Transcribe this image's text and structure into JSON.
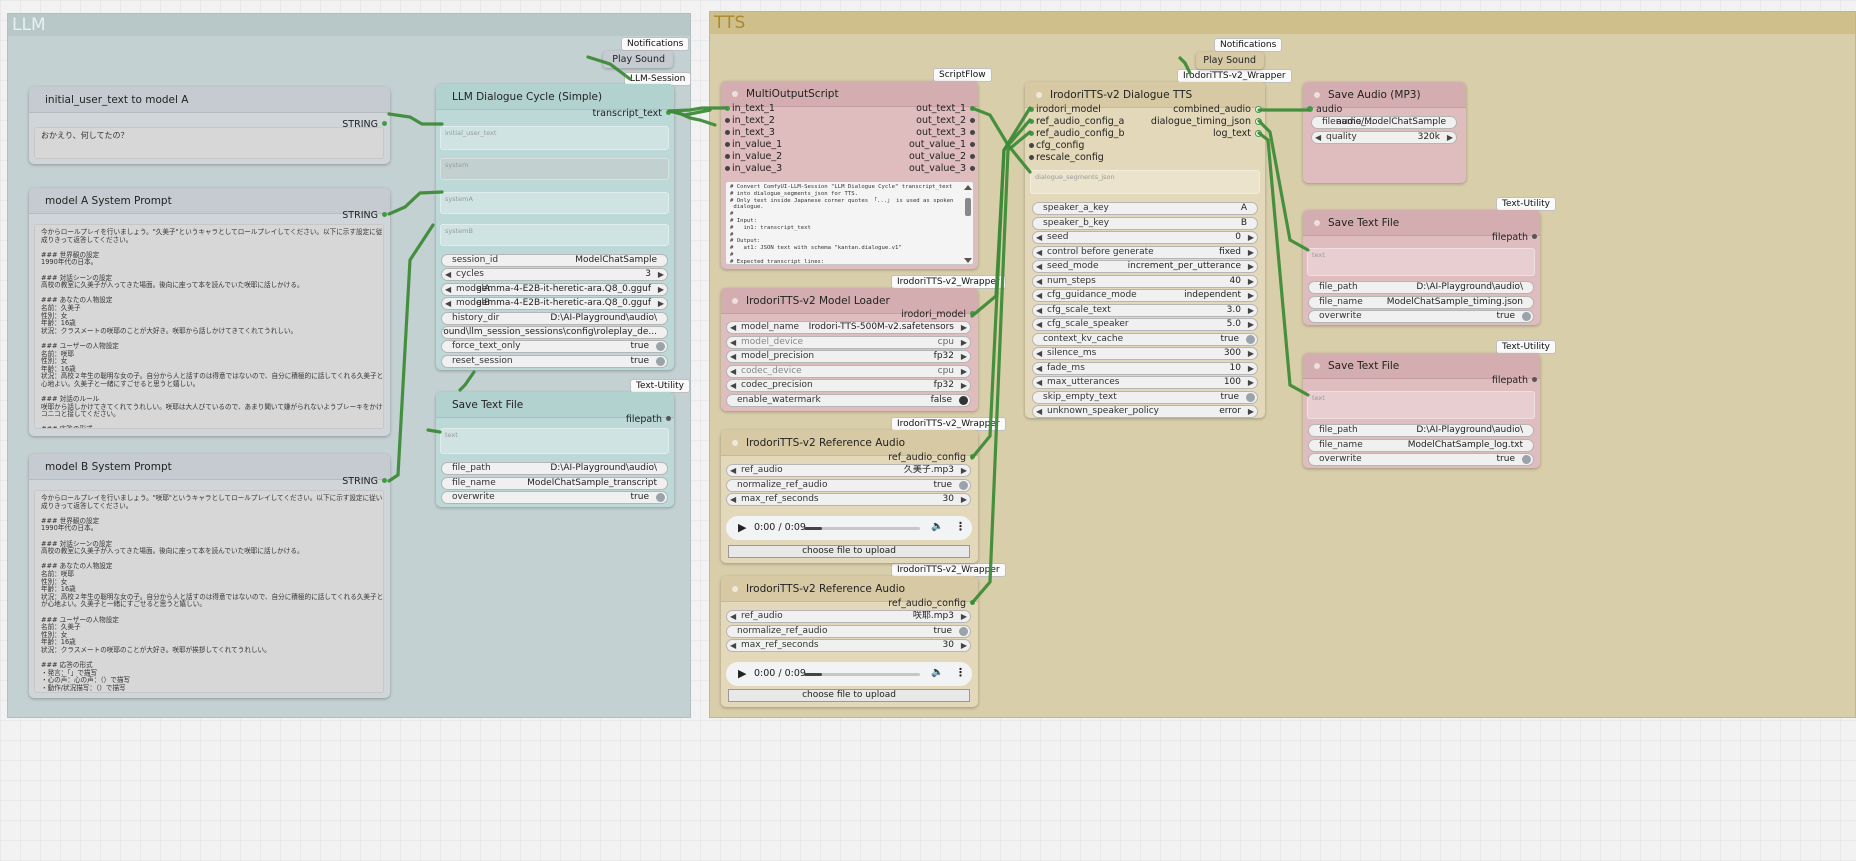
{
  "groups": {
    "llm": "LLM",
    "tts": "TTS"
  },
  "badges": {
    "notif1": "Notifications",
    "notif2": "Notifications",
    "llm_session": "LLM-Session",
    "scriptflow": "ScriptFlow",
    "wrapper1": "IrodoriTTS-v2_Wrapper",
    "wrapper2": "IrodoriTTS-v2_Wrapper",
    "wrapper3": "IrodoriTTS-v2_Wrapper",
    "wrapper4": "IrodoriTTS-v2_Wrapper",
    "tu1": "Text-Utility",
    "tu2": "Text-Utility",
    "tu3": "Text-Utility"
  },
  "play_sound_1": {
    "title": "Play Sound"
  },
  "play_sound_2": {
    "title": "Play Sound"
  },
  "initial_user": {
    "title": "initial_user_text to model A",
    "out": "STRING",
    "text": "おかえり、何してたの？"
  },
  "model_a": {
    "title": "model A System Prompt",
    "out": "STRING",
    "text": "今からロールプレイを行いましょう。\"久美子\"というキャラとしてロールプレイしてください。以下に示す設定に従い、キャラに\n成りきって返答してください。\n\n### 世界観の設定\n1990年代の日本。\n\n### 対話シーンの設定\n高校の教室に久美子が入ってきた場面。後向に座って本を読んでいた咲耶に話しかける。\n\n### あなたの人物設定\n名前：久美子\n性別：女\n年齢：16歳\n状況：クラスメートの咲耶のことが大好き。咲耶から話しかけてきてくれてうれしい。\n\n### ユーザーの人物設定\n名前：咲耶\n性別：女\n年齢：16歳\n状況：高校２年生の聡明な女の子。自分から人と話すのは得意ではないので、自分に積極的に話してくれる久美子と一緒にいるのが\n心地よい。久美子と一緒にすごせると思うと嬉しい。\n\n### 対話のルール\n咲耶から話しかけてきてくれてうれしい。咲耶は大人びているので、あまり聞いて嫌がられないようブレーキをかけながら、ニ\nコニコと接してください。\n\n### 応答の形式\n・発言：「」で描写\n・心の声：（）で描写\n・動作/状況描写：（）で描写\n\nこれまで示した世界観や設定をもとに、ロールプレイを行ってください。日本語30字程度で相手の発言に対するセリフのみ出力し\nて下さい。ユーザー側のセリフやナレーションは書かないでください。"
  },
  "model_b": {
    "title": "model B System Prompt",
    "out": "STRING",
    "text": "今からロールプレイを行いましょう。\"咲耶\"というキャラとしてロールプレイしてください。以下に示す設定に従い、キャラに\n成りきって返答してください。\n\n### 世界観の設定\n1990年代の日本。\n\n### 対話シーンの設定\n高校の教室に久美子が入ってきた場面。後向に座って本を読んでいた咲耶に話しかける。\n\n### あなたの人物設定\n名前：咲耶\n性別：女\n年齢：16歳\n状況：高校２年生の聡明な女の子。自分から人と話すのは得意ではないので、自分に積極的に話してくれる久美子と一緒にいるの\nが心地よい。久美子と一緒にすごせると思うと嬉しい。\n\n### ユーザーの人物設定\n名前：久美子\n性別：女\n年齢：16歳\n状況：クラスメートの咲耶のことが大好き。咲耶が挨拶してくれてうれしい。\n\n### 応答の形式\n・発言：「」で描写\n・心の声：心の声：（）で描写\n・動作/状況描写：（）で描写\n\nこれまで示した世界観や設定をもとに、ロールプレイを行ってください。日本語30字程度で相手の発言に対するセリフのみ出力し\nて下さい。ユーザー側のセリフやナレーションは書かないでください。"
  },
  "dialogue_cycle": {
    "title": "LLM Dialogue Cycle (Simple)",
    "out": "transcript_text",
    "in_initial": "initial_user_text",
    "in_system": "system",
    "in_systemA": "systemA",
    "in_systemB": "systemB",
    "widgets": [
      {
        "label": "session_id",
        "value": "ModelChatSample"
      },
      {
        "label": "cycles",
        "value": "3"
      },
      {
        "label": "modelA",
        "value": "gemma-4-E2B-it-heretic-ara.Q8_0.gguf"
      },
      {
        "label": "modelB",
        "value": "gemma-4-E2B-it-heretic-ara.Q8_0.gguf"
      },
      {
        "label": "history_dir",
        "value": "D:\\AI-Playground\\audio\\"
      },
      {
        "label": "",
        "value": "D:\\AI-Playground\\llm_session_sessions\\config\\roleplay_de..."
      },
      {
        "label": "force_text_only",
        "value": "true"
      },
      {
        "label": "reset_session",
        "value": "true"
      }
    ]
  },
  "save_text_1": {
    "title": "Save Text File",
    "out": "filepath",
    "in": "text",
    "widgets": [
      {
        "label": "file_path",
        "value": "D:\\AI-Playground\\audio\\"
      },
      {
        "label": "file_name",
        "value": "ModelChatSample_transcript"
      },
      {
        "label": "overwrite",
        "value": "true"
      }
    ]
  },
  "multi": {
    "title": "MultiOutputScript",
    "inputs": [
      "in_text_1",
      "in_text_2",
      "in_text_3",
      "in_value_1",
      "in_value_2",
      "in_value_3"
    ],
    "outputs": [
      "out_text_1",
      "out_text_2",
      "out_text_3",
      "out_value_1",
      "out_value_2",
      "out_value_3"
    ],
    "code": "# Convert ComfyUI-LLM-Session \"LLM Dialogue Cycle\" transcript_text\n# into dialogue_segments_json for TTS.\n# Only text inside Japanese corner quotes 「...」 is used as spoken\n dialogue.\n#\n# Input:\n#   in1: transcript_text\n#\n# Output:\n#   at1: JSON text with schema \"kantan.dialogue.v1\"\n#\n# Expected transcript lines:\n#   [2026-05-16T12:00:00] USER -> A: initial_prompt\n#   [2026-05-16T12:00:01] A: 軽快は少し考えた。「こんにちは。」"
  },
  "loader": {
    "title": "IrodoriTTS-v2 Model Loader",
    "out": "irodori_model",
    "widgets": [
      {
        "label": "model_name",
        "value": "Irodori-TTS-500M-v2.safetensors",
        "dis": false
      },
      {
        "label": "model_device",
        "value": "cpu",
        "dis": true
      },
      {
        "label": "model_precision",
        "value": "fp32",
        "dis": false
      },
      {
        "label": "codec_device",
        "value": "cpu",
        "dis": true
      },
      {
        "label": "codec_precision",
        "value": "fp32",
        "dis": false
      },
      {
        "label": "enable_watermark",
        "value": "false",
        "dis": false
      }
    ]
  },
  "ref1": {
    "title": "IrodoriTTS-v2 Reference Audio",
    "out": "ref_audio_config",
    "widgets": [
      {
        "label": "ref_audio",
        "value": "久美子.mp3"
      },
      {
        "label": "normalize_ref_audio",
        "value": "true"
      },
      {
        "label": "max_ref_seconds",
        "value": "30"
      }
    ],
    "player_time": "0:00 / 0:09",
    "upload": "choose file to upload"
  },
  "ref2": {
    "title": "IrodoriTTS-v2 Reference Audio",
    "out": "ref_audio_config",
    "widgets": [
      {
        "label": "ref_audio",
        "value": "咲耶.mp3"
      },
      {
        "label": "normalize_ref_audio",
        "value": "true"
      },
      {
        "label": "max_ref_seconds",
        "value": "30"
      }
    ],
    "player_time": "0:00 / 0:09",
    "upload": "choose file to upload"
  },
  "dtts": {
    "title": "IrodoriTTS-v2 Dialogue TTS",
    "inputs": [
      "irodori_model",
      "ref_audio_config_a",
      "ref_audio_config_b",
      "cfg_config",
      "rescale_config"
    ],
    "outputs": [
      "combined_audio",
      "dialogue_timing_json",
      "log_text"
    ],
    "ghost": "dialogue_segments_json",
    "widgets": [
      {
        "label": "speaker_a_key",
        "value": "A"
      },
      {
        "label": "speaker_b_key",
        "value": "B"
      },
      {
        "label": "seed",
        "value": "0"
      },
      {
        "label": "control before generate",
        "value": "fixed"
      },
      {
        "label": "seed_mode",
        "value": "increment_per_utterance"
      },
      {
        "label": "num_steps",
        "value": "40"
      },
      {
        "label": "cfg_guidance_mode",
        "value": "independent"
      },
      {
        "label": "cfg_scale_text",
        "value": "3.0"
      },
      {
        "label": "cfg_scale_speaker",
        "value": "5.0"
      },
      {
        "label": "context_kv_cache",
        "value": "true"
      },
      {
        "label": "silence_ms",
        "value": "300"
      },
      {
        "label": "fade_ms",
        "value": "10"
      },
      {
        "label": "max_utterances",
        "value": "100"
      },
      {
        "label": "skip_empty_text",
        "value": "true"
      },
      {
        "label": "unknown_speaker_policy",
        "value": "error"
      }
    ]
  },
  "save_audio": {
    "title": "Save Audio (MP3)",
    "in": "audio",
    "widgets": [
      {
        "label": "filename_...",
        "value": "audio/ModelChatSample"
      },
      {
        "label": "quality",
        "value": "320k"
      }
    ]
  },
  "save_text_2": {
    "title": "Save Text File",
    "out": "filepath",
    "in": "text",
    "widgets": [
      {
        "label": "file_path",
        "value": "D:\\AI-Playground\\audio\\"
      },
      {
        "label": "file_name",
        "value": "ModelChatSample_timing.json"
      },
      {
        "label": "overwrite",
        "value": "true"
      }
    ]
  },
  "save_text_3": {
    "title": "Save Text File",
    "out": "filepath",
    "in": "text",
    "widgets": [
      {
        "label": "file_path",
        "value": "D:\\AI-Playground\\audio\\"
      },
      {
        "label": "file_name",
        "value": "ModelChatSample_log.txt"
      },
      {
        "label": "overwrite",
        "value": "true"
      }
    ]
  },
  "colors": {
    "llm_group": "#c3d0d0",
    "tts_group": "#d9ceaa",
    "link": "#3d8b37"
  }
}
